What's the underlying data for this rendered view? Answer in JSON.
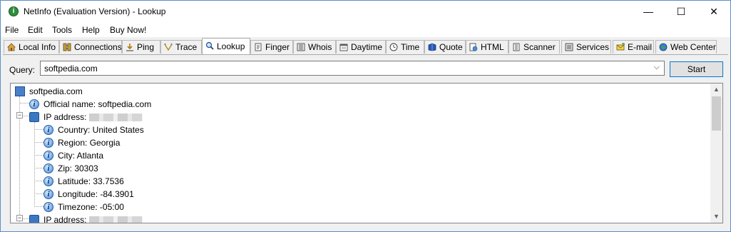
{
  "window": {
    "title": "NetInfo (Evaluation Version) - Lookup",
    "app_icon_glyph": "i",
    "controls": {
      "minimize": "—",
      "maximize": "☐",
      "close": "✕"
    }
  },
  "menu": {
    "items": [
      "File",
      "Edit",
      "Tools",
      "Help",
      "Buy Now!"
    ]
  },
  "tabs": [
    {
      "label": "Local Info",
      "icon": "house-icon"
    },
    {
      "label": "Connections",
      "icon": "connections-icon"
    },
    {
      "label": "Ping",
      "icon": "ping-icon"
    },
    {
      "label": "Trace",
      "icon": "trace-icon"
    },
    {
      "label": "Lookup",
      "icon": "magnifier-icon",
      "active": true
    },
    {
      "label": "Finger",
      "icon": "finger-icon"
    },
    {
      "label": "Whois",
      "icon": "book-icon"
    },
    {
      "label": "Daytime",
      "icon": "calendar-icon"
    },
    {
      "label": "Time",
      "icon": "clock-icon"
    },
    {
      "label": "Quote",
      "icon": "quote-book-icon"
    },
    {
      "label": "HTML",
      "icon": "html-icon"
    },
    {
      "label": "Scanner",
      "icon": "scanner-icon"
    },
    {
      "label": "Services",
      "icon": "services-icon"
    },
    {
      "label": "E-mail",
      "icon": "email-icon"
    },
    {
      "label": "Web Center",
      "icon": "globe-icon"
    }
  ],
  "query": {
    "label": "Query:",
    "value": "softpedia.com",
    "start_label": "Start"
  },
  "tree": {
    "root": "softpedia.com",
    "official_name": "Official name: softpedia.com",
    "ip_label_1": "IP address:",
    "country": "Country: United States",
    "region": "Region: Georgia",
    "city": "City: Atlanta",
    "zip": "Zip: 30303",
    "latitude": "Latitude: 33.7536",
    "longitude": "Longitude: -84.3901",
    "timezone": "Timezone: -05:00",
    "ip_label_2": "IP address:"
  },
  "colors": {
    "accent": "#0078d7",
    "tree_info_icon": "#6aa5e6"
  }
}
